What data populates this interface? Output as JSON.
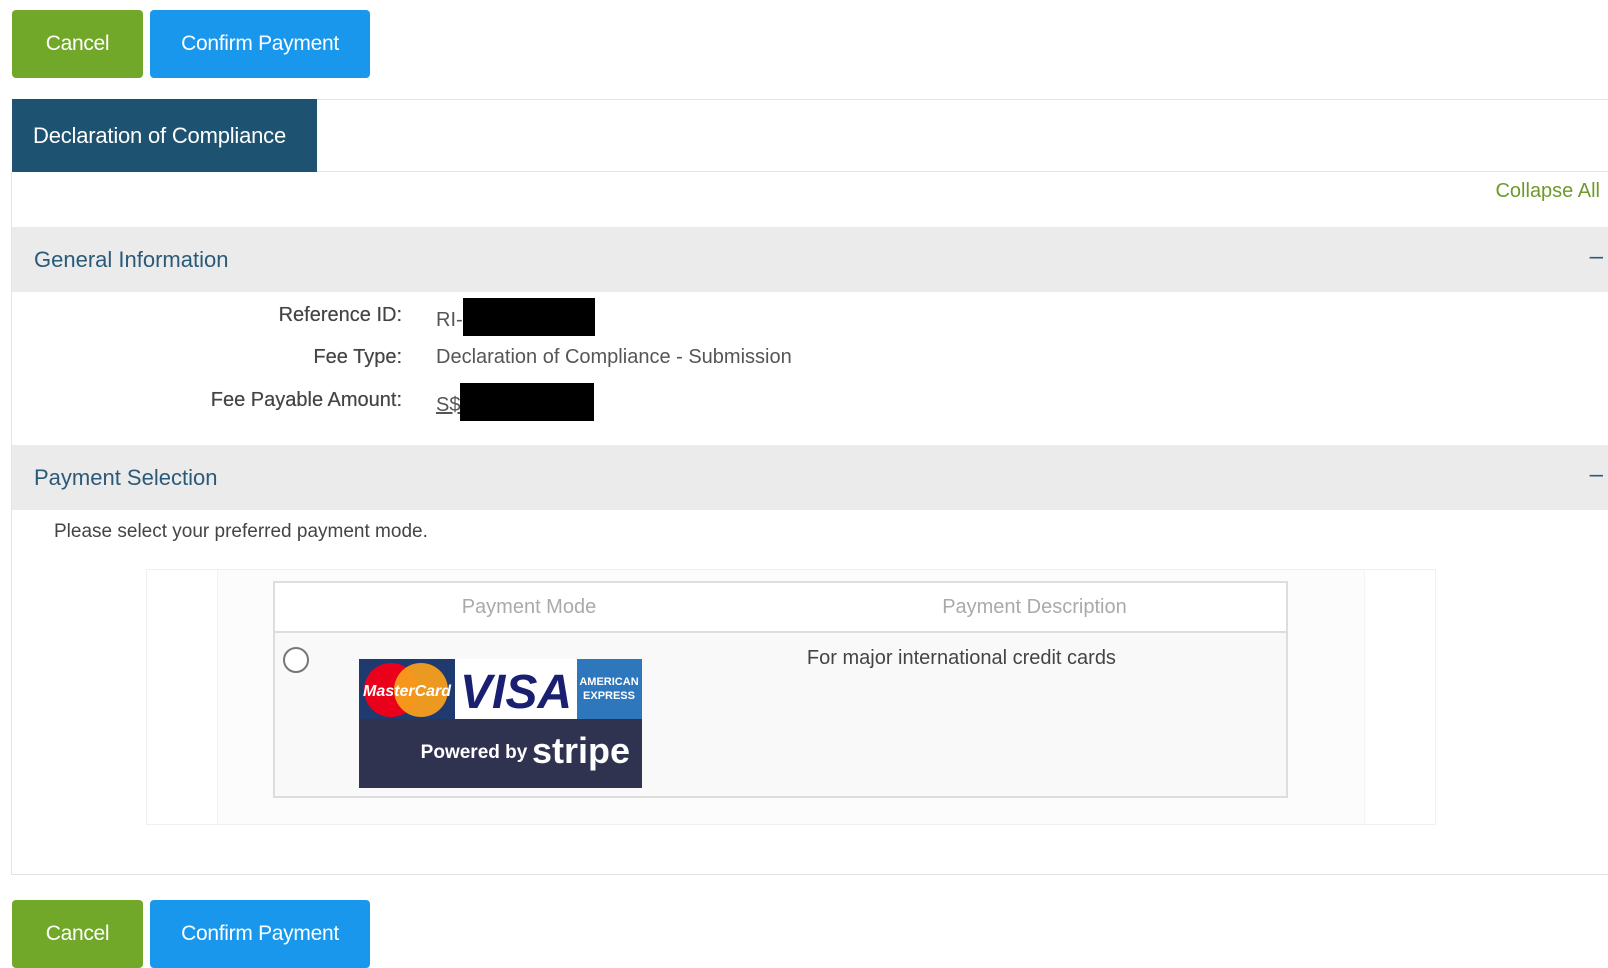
{
  "actions": {
    "cancel_label": "Cancel",
    "confirm_label": "Confirm Payment"
  },
  "tab": {
    "active_label": "Declaration of Compliance"
  },
  "panel": {
    "collapse_all_label": "Collapse All"
  },
  "general_info": {
    "title": "General Information",
    "toggle": "–",
    "reference_id": {
      "label": "Reference ID:",
      "prefix": "RI-"
    },
    "fee_type": {
      "label": "Fee Type:",
      "value": "Declaration of Compliance - Submission"
    },
    "fee_amount": {
      "label": "Fee Payable Amount:",
      "prefix": "S$"
    }
  },
  "payment_selection": {
    "title": "Payment Selection",
    "toggle": "–",
    "instruction": "Please select your preferred payment mode.",
    "table": {
      "headers": [
        "Payment Mode",
        "Payment Description"
      ],
      "rows": [
        {
          "selected": false,
          "logo": {
            "brands": [
              "MasterCard",
              "VISA",
              "AMERICAN",
              "EXPRESS"
            ],
            "powered_by": "Powered by",
            "provider": "stripe"
          },
          "description": "For major international credit cards"
        }
      ]
    }
  },
  "colors": {
    "cancel": "#72a82a",
    "confirm": "#1897ec",
    "tab_active": "#1d5271",
    "section_title": "#2b5a78",
    "collapse_link": "#6f9a2b"
  }
}
